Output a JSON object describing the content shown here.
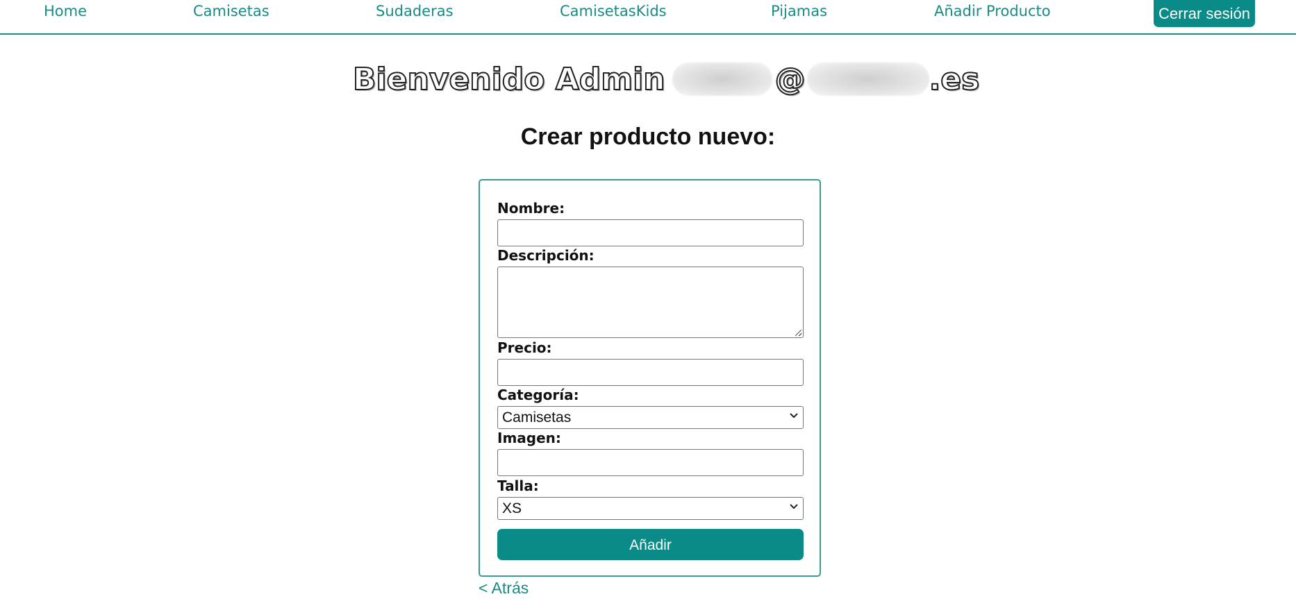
{
  "nav": {
    "links": [
      "Home",
      "Camisetas",
      "Sudaderas",
      "CamisetasKids",
      "Pijamas",
      "Añadir Producto"
    ],
    "logout_label": "Cerrar sesión"
  },
  "welcome": {
    "prefix": "Bienvenido Admin",
    "at": "@",
    "domain_suffix": ".es"
  },
  "page": {
    "title": "Crear producto nuevo:"
  },
  "form": {
    "nombre_label": "Nombre:",
    "nombre_value": "",
    "descripcion_label": "Descripción:",
    "descripcion_value": "",
    "precio_label": "Precio:",
    "precio_value": "",
    "categoria_label": "Categoría:",
    "categoria_selected": "Camisetas",
    "imagen_label": "Imagen:",
    "imagen_value": "",
    "talla_label": "Talla:",
    "talla_selected": "XS",
    "submit_label": "Añadir"
  },
  "back_link": "< Atrás",
  "colors": {
    "accent": "#0a8b87",
    "link": "#1a8a84"
  }
}
